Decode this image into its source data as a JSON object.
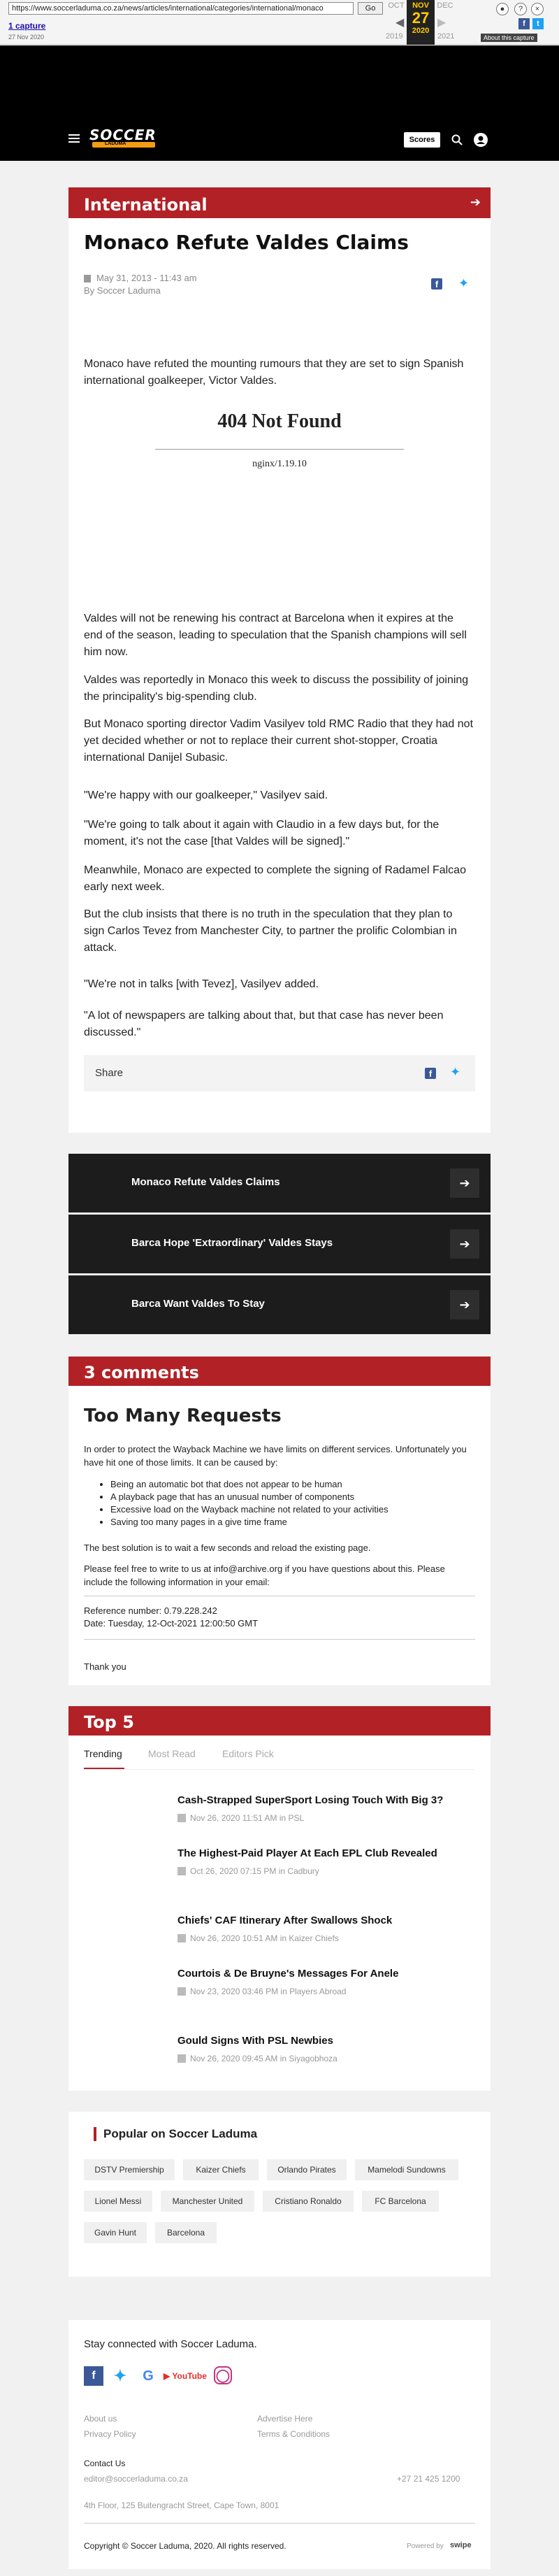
{
  "wayback": {
    "url": "https://www.soccerladuma.co.za/news/articles/international/categories/international/monaco",
    "go_label": "Go",
    "captures_link": "1 capture",
    "captures_dates": "27 Nov 2020",
    "months": [
      "OCT",
      "NOV",
      "DEC"
    ],
    "day": "27",
    "years": [
      "2019",
      "2020",
      "2021"
    ],
    "about_label": "About this capture"
  },
  "header": {
    "logo_text": "SOCCER",
    "logo_sub": "LADUMA",
    "scores_label": "Scores"
  },
  "article": {
    "category": "International",
    "title": "Monaco Refute Valdes Claims",
    "date": "May 31, 2013 - 11:43 am",
    "byline": "By Soccer Laduma",
    "intro": "Monaco have refuted the mounting rumours that they are set to sign Spanish international goalkeeper, Victor Valdes.",
    "embed_error_title": "404 Not Found",
    "embed_error_server": "nginx/1.19.10",
    "paragraphs": [
      "Valdes will not be renewing his contract at Barcelona when it expires at the end of the season, leading to speculation that the Spanish champions will sell him now.",
      "Valdes was reportedly in Monaco this week to discuss the possibility of joining the principality's big-spending club.",
      "But Monaco sporting director Vadim Vasilyev told RMC Radio that they had not yet decided whether or not to replace their current shot-stopper, Croatia international Danijel Subasic.",
      "\"We're happy with our goalkeeper,\" Vasilyev said.",
      "\"We're going to talk about it again with Claudio in a few days but, for the moment, it's not the case [that Valdes will be signed].\"",
      "Meanwhile, Monaco are expected to complete the signing of Radamel Falcao early next week.",
      "But the club insists that there is no truth in the speculation that they plan to sign Carlos Tevez from Manchester City, to partner the prolific Colombian in attack.",
      "\"We're not in talks [with Tevez], Vasilyev added.",
      "\"A lot of newspapers are talking about that, but that case has never been discussed.\""
    ],
    "share_label": "Share"
  },
  "related": [
    {
      "title": "Monaco Refute Valdes Claims"
    },
    {
      "title": "Barca Hope 'Extraordinary' Valdes Stays"
    },
    {
      "title": "Barca Want Valdes To Stay"
    }
  ],
  "comments": {
    "heading": "3 comments",
    "error_title": "Too Many Requests",
    "intro": "In order to protect the Wayback Machine we have limits on different services. Unfortunately you have hit one of those limits. It can be caused by:",
    "causes": [
      "Being an automatic bot that does not appear to be human",
      "A playback page that has an unusual number of components",
      "Excessive load on the Wayback machine not related to your activities",
      "Saving too many pages in a give time frame"
    ],
    "advice": "The best solution is to wait a few seconds and reload the existing page.",
    "contact": "Please feel free to write to us at info@archive.org if you have questions about this. Please include the following information in your email:",
    "reference": "Reference number: 0.79.228.242",
    "date": "Date: Tuesday, 12-Oct-2021 12:00:50 GMT",
    "thanks": "Thank you"
  },
  "top5": {
    "heading": "Top 5",
    "tabs": [
      "Trending",
      "Most Read",
      "Editors Pick"
    ],
    "items": [
      {
        "title": "Cash-Strapped SuperSport Losing Touch With Big 3?",
        "meta": "Nov 26, 2020 11:51 AM in PSL"
      },
      {
        "title": "The Highest-Paid Player At Each EPL Club Revealed",
        "meta": "Oct 26, 2020 07:15 PM in Cadbury"
      },
      {
        "title": "Chiefs' CAF Itinerary After Swallows Shock",
        "meta": "Nov 26, 2020 10:51 AM in Kaizer Chiefs"
      },
      {
        "title": "Courtois & De Bruyne's Messages For Anele",
        "meta": "Nov 23, 2020 03:46 PM in Players Abroad"
      },
      {
        "title": "Gould Signs With PSL Newbies",
        "meta": "Nov 26, 2020 09:45 AM in Siyagobhoza"
      }
    ]
  },
  "popular": {
    "heading": "Popular on Soccer Laduma",
    "tags": [
      "DSTV Premiership",
      "Kaizer Chiefs",
      "Orlando Pirates",
      "Mamelodi Sundowns",
      "Lionel Messi",
      "Manchester United",
      "Cristiano Ronaldo",
      "FC Barcelona",
      "Gavin Hunt",
      "Barcelona"
    ]
  },
  "footer": {
    "stay_connected": "Stay connected with Soccer Laduma.",
    "links": [
      "About us",
      "Privacy Policy",
      "Advertise Here",
      "Terms & Conditions"
    ],
    "contact_heading": "Contact Us",
    "email": "editor@soccerladuma.co.za",
    "phone": "+27 21 425 1200",
    "address": "4th Floor, 125 Buitengracht Street, Cape Town, 8001",
    "copyright": "Copyright © Soccer Laduma, 2020. All rights reserved.",
    "powered": "Powered by",
    "powered_brand": "swipe"
  },
  "colors": {
    "accent_red": "#b22126",
    "dark": "#1c1c1c",
    "facebook": "#3b5998",
    "twitter": "#1da1f2"
  }
}
